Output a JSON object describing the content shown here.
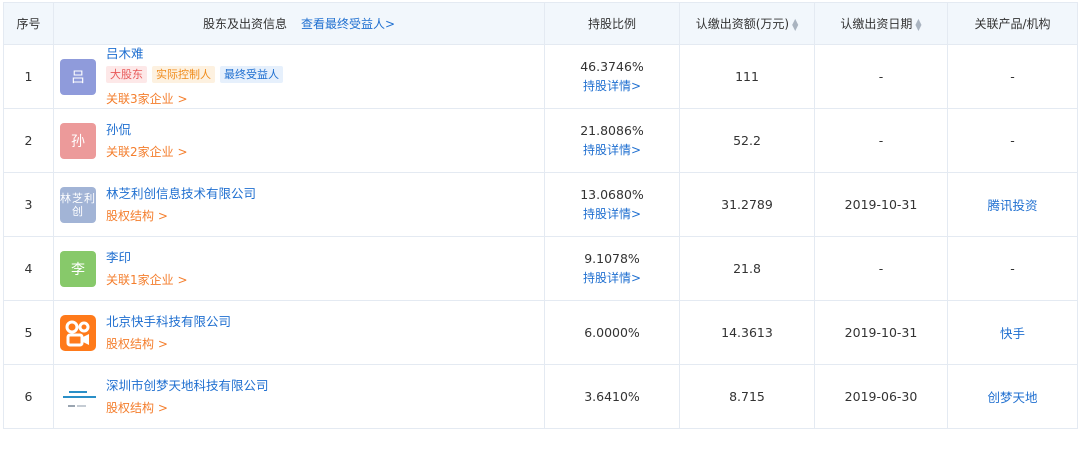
{
  "header": {
    "index": "序号",
    "holder": "股东及出资信息",
    "holder_link": "查看最终受益人>",
    "ratio": "持股比例",
    "amount": "认缴出资额(万元)",
    "date": "认缴出资日期",
    "related": "关联产品/机构"
  },
  "colors": {
    "link_blue": "#1f6fd0",
    "link_orange": "#f47e2d",
    "header_bg": "#f2f7fc",
    "border": "#e4eaf2"
  },
  "rows": [
    {
      "index": "1",
      "avatar_text": "吕",
      "avatar_color": "#8f9bdb",
      "name": "吕木难",
      "tags": [
        "大股东",
        "实际控制人",
        "最终受益人"
      ],
      "link": "关联3家企业 >",
      "ratio": "46.3746%",
      "detail": "持股详情>",
      "amount": "111",
      "date": "-",
      "related": "-"
    },
    {
      "index": "2",
      "avatar_text": "孙",
      "avatar_color": "#ec9a9a",
      "name": "孙侃",
      "tags": [],
      "link": "关联2家企业 >",
      "ratio": "21.8086%",
      "detail": "持股详情>",
      "amount": "52.2",
      "date": "-",
      "related": "-"
    },
    {
      "index": "3",
      "avatar_text": "林芝利创",
      "avatar_color": "#a2b4d6",
      "name": "林芝利创信息技术有限公司",
      "tags": [],
      "link": "股权结构 >",
      "ratio": "13.0680%",
      "detail": "持股详情>",
      "amount": "31.2789",
      "date": "2019-10-31",
      "related": "腾讯投资"
    },
    {
      "index": "4",
      "avatar_text": "李",
      "avatar_color": "#87c96a",
      "name": "李印",
      "tags": [],
      "link": "关联1家企业 >",
      "ratio": "9.1078%",
      "detail": "持股详情>",
      "amount": "21.8",
      "date": "-",
      "related": "-"
    },
    {
      "index": "5",
      "avatar_icon": "kuaishou-logo",
      "avatar_color": "#ff7a1a",
      "name": "北京快手科技有限公司",
      "tags": [],
      "link": "股权结构 >",
      "ratio": "6.0000%",
      "detail": "",
      "amount": "14.3613",
      "date": "2019-10-31",
      "related": "快手"
    },
    {
      "index": "6",
      "avatar_icon": "chuangmeng-logo",
      "avatar_color": "#2a8fc7",
      "name": "深圳市创梦天地科技有限公司",
      "tags": [],
      "link": "股权结构 >",
      "ratio": "3.6410%",
      "detail": "",
      "amount": "8.715",
      "date": "2019-06-30",
      "related": "创梦天地"
    }
  ]
}
